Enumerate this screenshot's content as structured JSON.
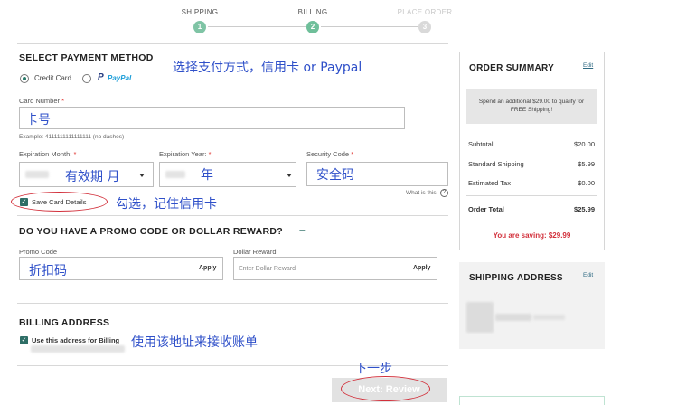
{
  "stepper": {
    "steps": [
      {
        "label": "SHIPPING",
        "num": "1",
        "color": "#7fc4a5"
      },
      {
        "label": "BILLING",
        "num": "2",
        "color": "#6fbf9a"
      },
      {
        "label": "PLACE ORDER",
        "num": "3",
        "color": "#d9d9d9"
      }
    ]
  },
  "payment": {
    "title": "SELECT PAYMENT METHOD",
    "credit_card_label": "Credit Card",
    "paypal_p": "P",
    "paypal_label": "PayPal",
    "annotation": "选择支付方式，信用卡 or Paypal"
  },
  "card_number": {
    "label": "Card Number",
    "required": "*",
    "value": "卡号",
    "example": "Example: 4111111111111111 (no dashes)"
  },
  "expiration_month": {
    "label": "Expiration Month:",
    "required": "*",
    "value": "有效期 月"
  },
  "expiration_year": {
    "label": "Expiration Year:",
    "required": "*",
    "value": "年"
  },
  "security_code": {
    "label": "Security Code",
    "required": "*",
    "value": "安全码",
    "help": "What is this",
    "help_icon": "?"
  },
  "save_card": {
    "label": "Save Card Details",
    "annotation": "勾选，记住信用卡"
  },
  "promo": {
    "title": "DO YOU HAVE A PROMO CODE OR DOLLAR REWARD?",
    "toggle": "–",
    "promo_label": "Promo Code",
    "promo_value": "折扣码",
    "promo_apply": "Apply",
    "reward_label": "Dollar Reward",
    "reward_placeholder": "Enter Dollar Reward",
    "reward_apply": "Apply"
  },
  "billing": {
    "title": "BILLING ADDRESS",
    "use_shipping_label": "Use this address for Billing",
    "annotation": "使用该地址来接收账单"
  },
  "next": {
    "annotation": "下一步",
    "label": "Next: Review"
  },
  "order_summary": {
    "title": "ORDER SUMMARY",
    "edit": "Edit",
    "promo_banner": "Spend an additional $29.00 to qualify for FREE Shipping!",
    "rows": [
      {
        "label": "Subtotal",
        "value": "$20.00"
      },
      {
        "label": "Standard Shipping",
        "value": "$5.99"
      },
      {
        "label": "Estimated Tax",
        "value": "$0.00"
      }
    ],
    "total_label": "Order Total",
    "total_value": "$25.99",
    "saving": "You are saving: $29.99",
    "saving_color": "#d2303b"
  },
  "shipping_address": {
    "title": "SHIPPING ADDRESS",
    "edit": "Edit"
  }
}
